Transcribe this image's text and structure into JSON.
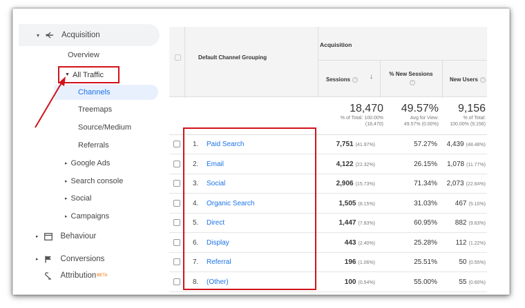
{
  "sidebar": {
    "acquisition": "Acquisition",
    "overview": "Overview",
    "all_traffic": "All Traffic",
    "channels": "Channels",
    "treemaps": "Treemaps",
    "source_medium": "Source/Medium",
    "referrals": "Referrals",
    "google_ads": "Google Ads",
    "search_console": "Search console",
    "social": "Social",
    "campaigns": "Campaigns",
    "behaviour": "Behaviour",
    "conversions": "Conversions",
    "attribution": "Attribution",
    "attribution_badge": "BETA"
  },
  "table": {
    "dimension_header": "Default Channel Grouping",
    "group_header": "Acquisition",
    "columns": {
      "sessions": "Sessions",
      "new_sessions": "% New Sessions",
      "new_users": "New Users"
    },
    "totals": {
      "sessions": "18,470",
      "sessions_sub1": "% of Total: 100.00%",
      "sessions_sub2": "(18,470)",
      "new_sessions": "49.57%",
      "new_sessions_sub1": "Avg for View:",
      "new_sessions_sub2": "49.57% (0.00%)",
      "new_users": "9,156",
      "new_users_sub1": "% of Total:",
      "new_users_sub2": "100.00% (9,156)"
    },
    "rows": [
      {
        "idx": "1.",
        "name": "Paid Search",
        "sessions": "7,751",
        "sessions_pct": "(41.97%)",
        "new_sessions": "57.27%",
        "new_users": "4,439",
        "new_users_pct": "(48.48%)"
      },
      {
        "idx": "2.",
        "name": "Email",
        "sessions": "4,122",
        "sessions_pct": "(22.32%)",
        "new_sessions": "26.15%",
        "new_users": "1,078",
        "new_users_pct": "(11.77%)"
      },
      {
        "idx": "3.",
        "name": "Social",
        "sessions": "2,906",
        "sessions_pct": "(15.73%)",
        "new_sessions": "71.34%",
        "new_users": "2,073",
        "new_users_pct": "(22.64%)"
      },
      {
        "idx": "4.",
        "name": "Organic Search",
        "sessions": "1,505",
        "sessions_pct": "(8.15%)",
        "new_sessions": "31.03%",
        "new_users": "467",
        "new_users_pct": "(5.10%)"
      },
      {
        "idx": "5.",
        "name": "Direct",
        "sessions": "1,447",
        "sessions_pct": "(7.83%)",
        "new_sessions": "60.95%",
        "new_users": "882",
        "new_users_pct": "(9.63%)"
      },
      {
        "idx": "6.",
        "name": "Display",
        "sessions": "443",
        "sessions_pct": "(2.40%)",
        "new_sessions": "25.28%",
        "new_users": "112",
        "new_users_pct": "(1.22%)"
      },
      {
        "idx": "7.",
        "name": "Referral",
        "sessions": "196",
        "sessions_pct": "(1.06%)",
        "new_sessions": "25.51%",
        "new_users": "50",
        "new_users_pct": "(0.55%)"
      },
      {
        "idx": "8.",
        "name": "(Other)",
        "sessions": "100",
        "sessions_pct": "(0.54%)",
        "new_sessions": "55.00%",
        "new_users": "55",
        "new_users_pct": "(0.60%)"
      }
    ]
  },
  "colors": {
    "highlight": "#d0121a",
    "link": "#1a73e8"
  }
}
